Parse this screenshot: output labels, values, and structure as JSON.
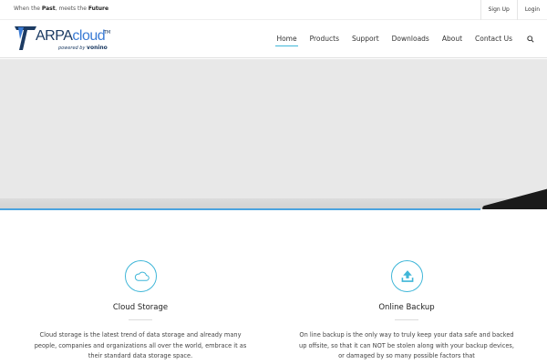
{
  "topbar": {
    "tagline_part1": "When the ",
    "tagline_bold1": "Past",
    "tagline_part2": ", meets the ",
    "tagline_bold2": "Future",
    "links": [
      "Sign Up",
      "Login"
    ]
  },
  "logo": {
    "brand_a": "ARPA",
    "brand_b": "cloud",
    "tm": "TM",
    "powered_by": "powered by",
    "powered_brand": "vonino"
  },
  "nav": {
    "items": [
      "Home",
      "Products",
      "Support",
      "Downloads",
      "About",
      "Contact Us"
    ],
    "active": "Home",
    "search_icon": "search-icon"
  },
  "colors": {
    "accent": "#3fb6d8",
    "hero_line": "#4aa3df",
    "hero_bg": "#e8e8e8",
    "logo_navy": "#1c3b63"
  },
  "features": [
    {
      "icon": "cloud-icon",
      "title": "Cloud Storage",
      "text": "Cloud storage is the latest trend of data storage and already many people, companies and organizations all over the world, embrace it as their standard data storage space."
    },
    {
      "icon": "upload-icon",
      "title": "Online Backup",
      "text": "On line backup is the only way to truly keep your data safe and backed up offsite, so that it can NOT be stolen along with your backup devices, or damaged by so many possible factors that"
    }
  ]
}
